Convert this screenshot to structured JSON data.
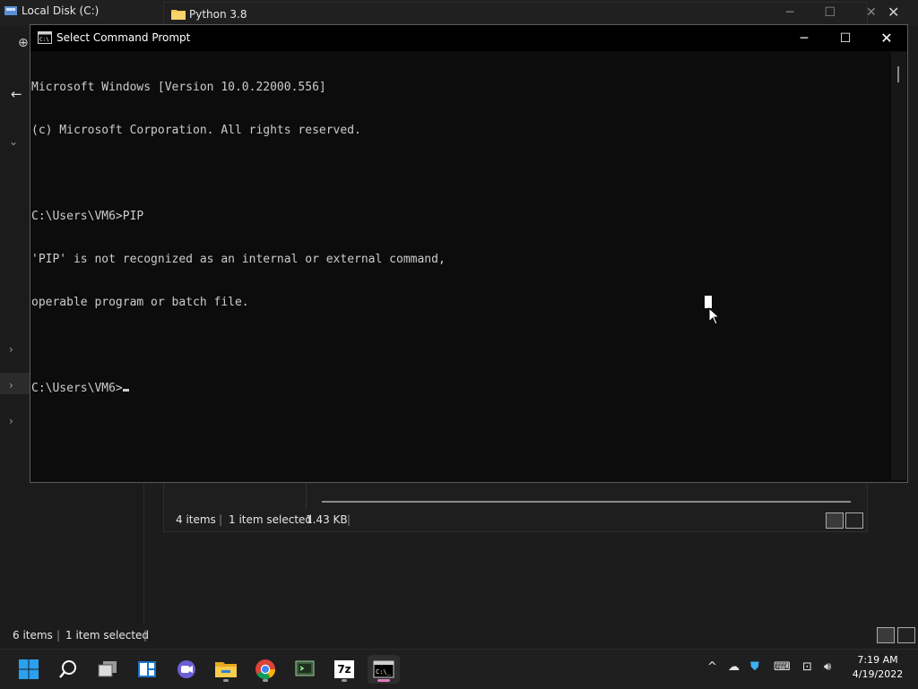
{
  "background_explorer": {
    "title": "Local Disk (C:)",
    "status_items": "6 items",
    "status_selected": "1 item selected"
  },
  "python_explorer": {
    "title": "Python 3.8",
    "status_items": "4 items",
    "status_selected": "1 item selected",
    "status_size": "1.43 KB"
  },
  "cmd": {
    "title": "Select Command Prompt",
    "lines": [
      "Microsoft Windows [Version 10.0.22000.556]",
      "(c) Microsoft Corporation. All rights reserved.",
      "",
      "C:\\Users\\VM6>PIP",
      "'PIP' is not recognized as an internal or external command,",
      "operable program or batch file.",
      "",
      "C:\\Users\\VM6>"
    ]
  },
  "taskbar": {
    "time": "7:19 AM",
    "date": "4/19/2022",
    "apps": [
      "start",
      "search",
      "task-view",
      "widgets",
      "teams-chat",
      "file-explorer",
      "chrome",
      "terminal-tool",
      "7zip",
      "command-prompt"
    ],
    "app_7zip_label": "7z"
  }
}
